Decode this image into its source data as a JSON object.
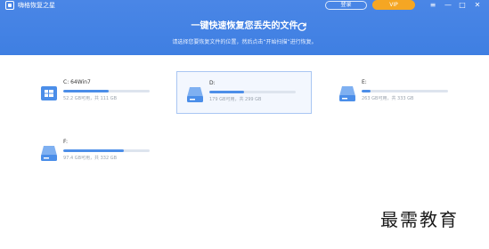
{
  "app": {
    "name": "嗨格恢复之星"
  },
  "header": {
    "login_label": "登录",
    "vip_label": "VIP",
    "window_controls": {
      "menu": "≡",
      "minimize": "—",
      "maximize": "□",
      "close": "✕"
    },
    "headline": "一键快速恢复您丢失的文件",
    "subline": "请选择您要恢复文件的位置，然后点击“开始扫描”进行恢复。"
  },
  "drives": [
    {
      "name": "C: 64Win7",
      "usage": "52.2 GB可用，共 111 GB",
      "used_fraction": 0.53
    },
    {
      "name": "D:",
      "usage": "179 GB可用，共 299 GB",
      "used_fraction": 0.4,
      "selected": true
    },
    {
      "name": "E:",
      "usage": "263 GB可用，共 333 GB",
      "used_fraction": 0.1
    },
    {
      "name": "F:",
      "usage": "97.4 GB可用，共 332 GB",
      "used_fraction": 0.7
    }
  ],
  "colors": {
    "header": "#4a86e6",
    "accent": "#4c8ee8",
    "vip": "#f5a623",
    "track": "#dde4ee"
  },
  "icons": {
    "logo": "app-logo-icon",
    "refresh": "refresh-icon",
    "drive": "drive-icon"
  },
  "watermark": "最需教育"
}
